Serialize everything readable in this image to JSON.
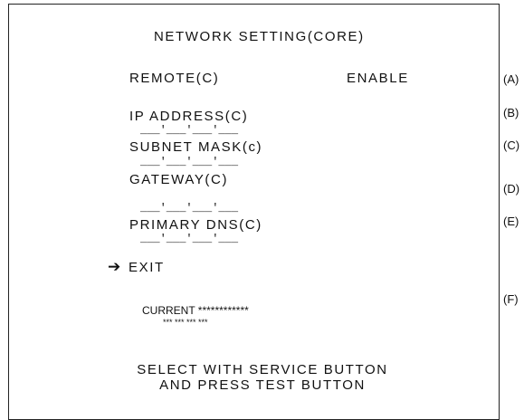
{
  "screen": {
    "title": "NETWORK SETTING(CORE)",
    "items": [
      {
        "label": "REMOTE(C)",
        "value": "ENABLE"
      },
      {
        "label": "IP ADDRESS(C)",
        "ip": "___'___'___'___"
      },
      {
        "label": "SUBNET MASK(c)",
        "ip": "___'___'___'___"
      },
      {
        "label": "GATEWAY(C)",
        "ip": "___'___'___'___"
      },
      {
        "label": "PRIMARY DNS(C)",
        "ip": "___'___'___'___"
      }
    ],
    "cursor_icon": "arrow-right-icon",
    "cursor_glyph": "➔",
    "exit_label": "EXIT",
    "current_label": "CURRENT ************",
    "current_ip": "*** *** *** ***",
    "instruction_line1": "SELECT WITH SERVICE BUTTON",
    "instruction_line2": "AND PRESS TEST BUTTON"
  },
  "annotations": [
    "(A)",
    "(B)",
    "(C)",
    "(D)",
    "(E)",
    "(F)"
  ]
}
